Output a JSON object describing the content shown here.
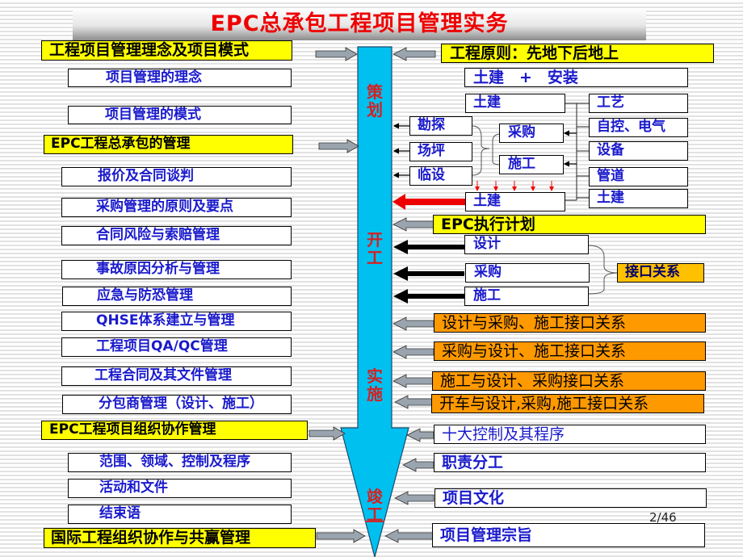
{
  "title": "EPC总承包工程项目管理实务",
  "page_indicator": "2/46",
  "colors": {
    "title": "#ee0000",
    "spine": "#00c0f0",
    "stage_label": "#d62020",
    "yellow_box": "#ffff00",
    "orange_box": "#ff9900",
    "gold_box": "#ffc000",
    "blue_text": "#1a1acc",
    "arrow_gray": "#9aa4ae",
    "arrow_red": "#ee0000"
  },
  "stages": [
    "策划",
    "开工",
    "实施",
    "竣工"
  ],
  "left": {
    "sections": [
      {
        "heading": "工程项目管理理念及项目模式",
        "items": [
          "项目管理的理念",
          "项目管理的模式"
        ]
      },
      {
        "heading": "EPC工程总承包的管理",
        "items": [
          "报价及合同谈判",
          "采购管理的原则及要点",
          "合同风险与索赔管理",
          "事故原因分析与管理",
          "应急与防恐管理",
          "QHSE体系建立与管理",
          "工程项目QA/QC管理",
          "工程合同及其文件管理",
          "分包商管理（设计、施工）"
        ]
      },
      {
        "heading": "EPC工程项目组织协作管理",
        "items": [
          "范围、领域、控制及程序",
          "活动和文件",
          "结束语"
        ]
      },
      {
        "heading": "国际工程组织协作与共赢管理",
        "items": []
      }
    ]
  },
  "right": {
    "principle": "工程原则：先地下后地上",
    "civil_plus_install": "土建　+　安装",
    "planning": {
      "civil_top": "土建",
      "civil_bottom": "土建",
      "prep": [
        "勘探",
        "场坪",
        "临设"
      ],
      "middle": [
        "采购",
        "施工"
      ],
      "install": [
        "工艺",
        "自控、电气",
        "设备",
        "管道",
        "土建"
      ]
    },
    "epc_plan": "EPC执行计划",
    "execution": [
      "设计",
      "采购",
      "施工"
    ],
    "interface": "接口关系",
    "interfaces": [
      "设计与采购、施工接口关系",
      "采购与设计、施工接口关系",
      "施工与设计、采购接口关系",
      "开车与设计,采购,施工接口关系"
    ],
    "closing": [
      "十大控制及其程序",
      "职责分工",
      "项目文化",
      "项目管理宗旨"
    ]
  }
}
